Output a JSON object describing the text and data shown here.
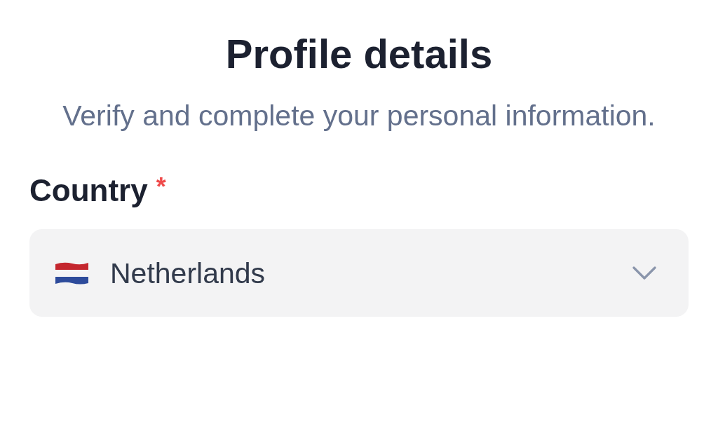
{
  "header": {
    "title": "Profile details",
    "subtitle": "Verify and complete your personal information."
  },
  "fields": [
    {
      "kind": "select",
      "label": "Country",
      "required_mark": "*",
      "value": "Netherlands"
    }
  ]
}
